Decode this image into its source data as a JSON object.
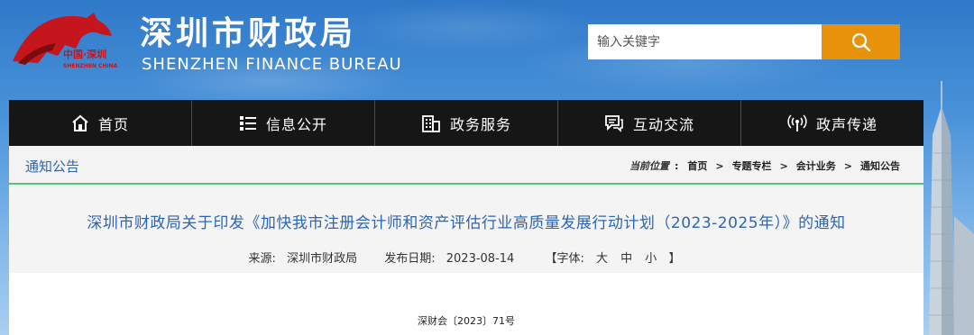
{
  "header": {
    "logo_text_cn": "中国·深圳",
    "logo_text_en": "SHENZHEN CHINA",
    "title": "深圳市财政局",
    "subtitle": "SHENZHEN FINANCE BUREAU"
  },
  "search": {
    "placeholder": "输入关键字",
    "button_icon": "search-icon"
  },
  "nav": {
    "items": [
      {
        "label": "首页",
        "icon": "home-icon"
      },
      {
        "label": "信息公开",
        "icon": "list-icon"
      },
      {
        "label": "政务服务",
        "icon": "building-icon"
      },
      {
        "label": "互动交流",
        "icon": "chat-icon"
      },
      {
        "label": "政声传递",
        "icon": "broadcast-icon"
      }
    ]
  },
  "breadcrumb": {
    "section": "通知公告",
    "current_label": "当前位置",
    "items": [
      "首页",
      "专题专栏",
      "会计业务",
      "通知公告"
    ]
  },
  "article": {
    "title": "深圳市财政局关于印发《加快我市注册会计师和资产评估行业高质量发展行动计划（2023-2025年）》的通知",
    "source_label": "来源:",
    "source_value": "深圳市财政局",
    "date_label": "发布日期:",
    "date_value": "2023-08-14",
    "font_label": "【字体:",
    "font_sizes": [
      "大",
      "中",
      "小"
    ],
    "font_close": "】",
    "doc_number": "深财会〔2023〕71号"
  },
  "colors": {
    "nav_bg": "#161616",
    "search_button": "#e8920c",
    "link_blue": "#2a66b8",
    "accent_green": "#53c47a"
  }
}
